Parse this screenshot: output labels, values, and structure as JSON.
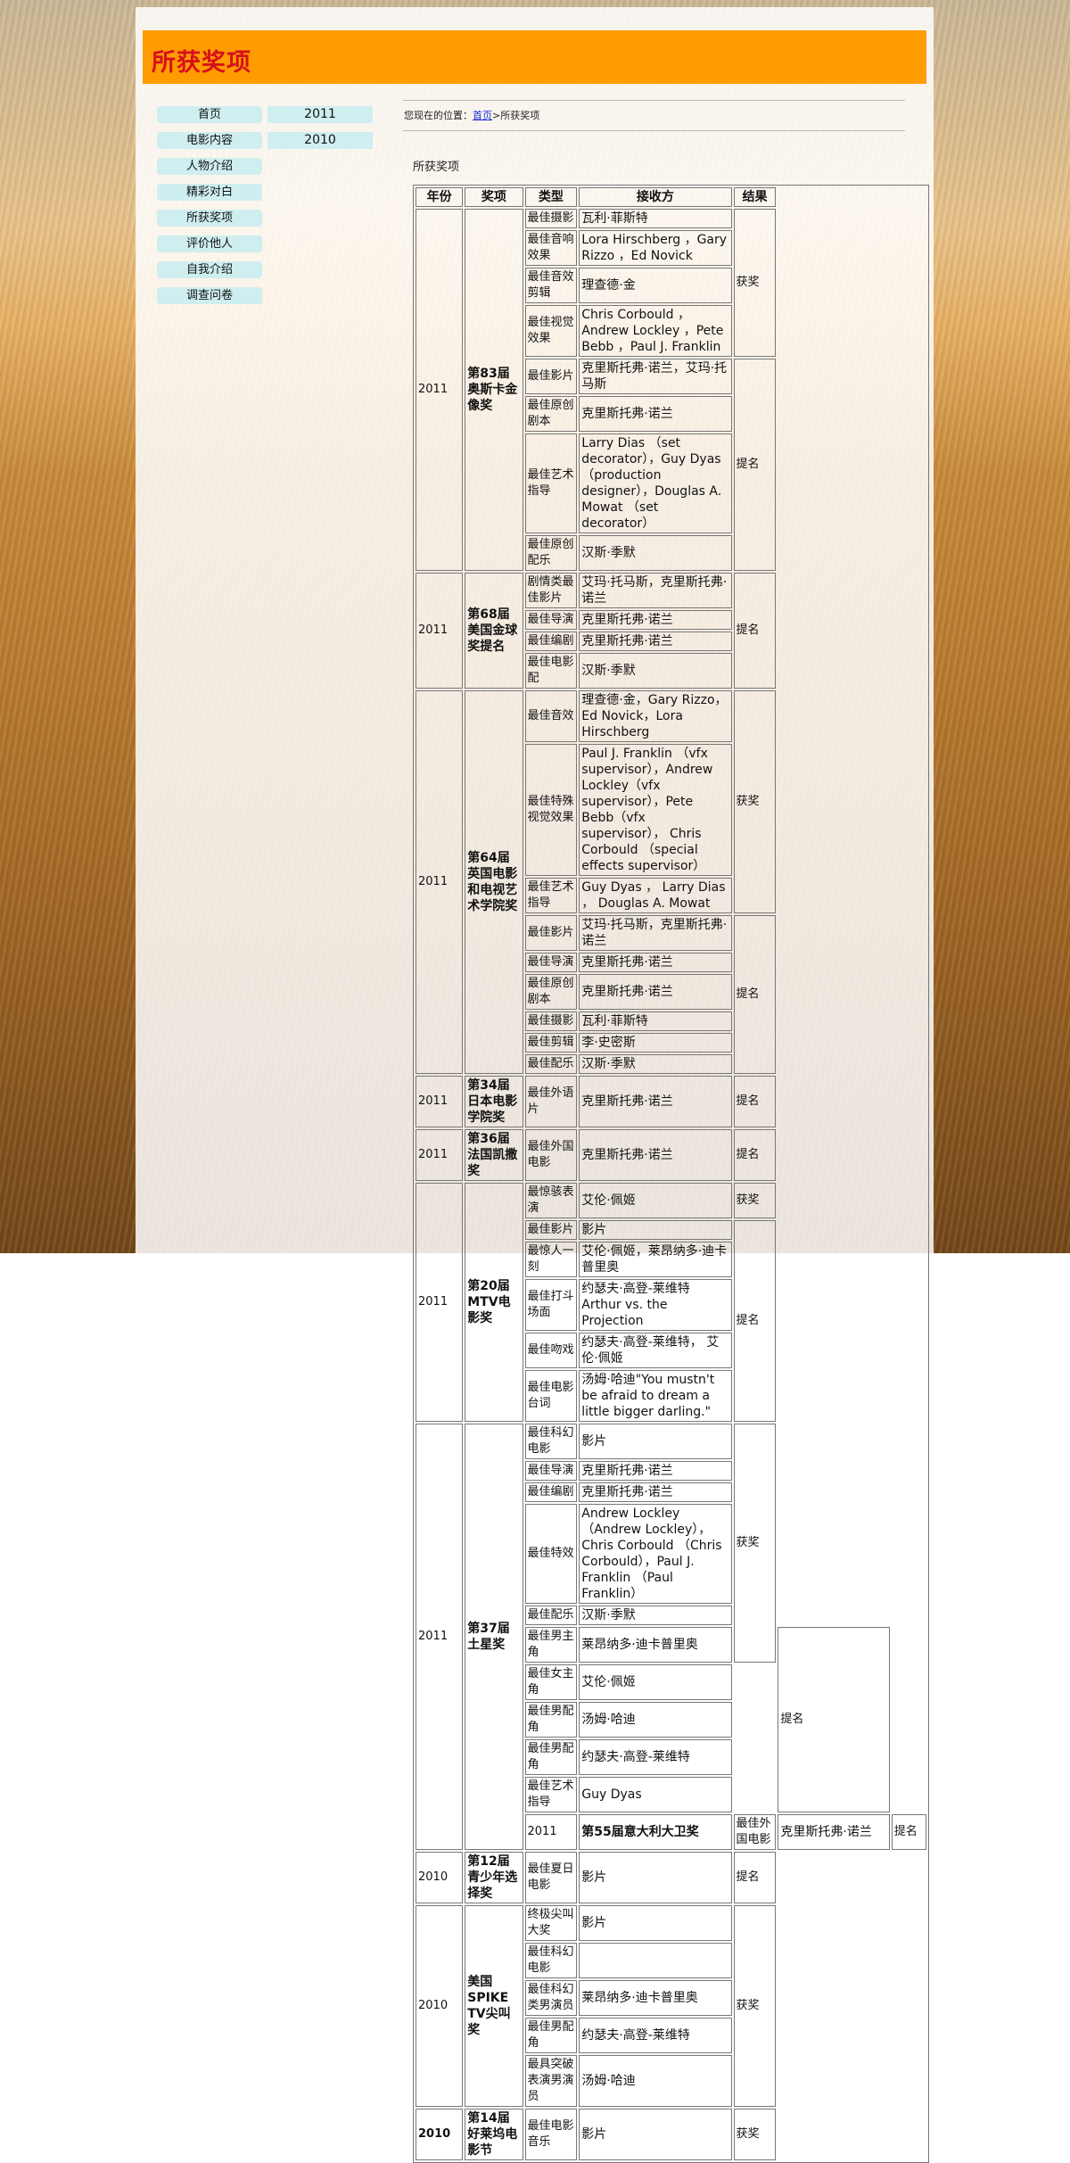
{
  "banner": {
    "title": "所获奖项"
  },
  "nav": {
    "items": [
      "首页",
      "电影内容",
      "人物介绍",
      "精彩对白",
      "所获奖项",
      "评价他人",
      "自我介绍",
      "调查问卷"
    ]
  },
  "years": [
    "2011",
    "2010"
  ],
  "breadcrumb": {
    "prefix": "您现在的位置：",
    "home": "首页",
    "sep": ">",
    "current": "所获奖项"
  },
  "section_title": "所获奖项",
  "table": {
    "headers": [
      "年份",
      "奖项",
      "类型",
      "接收方",
      "结果"
    ],
    "rows": [
      {
        "y": "2011",
        "a": "第83届奥斯卡金像奖",
        "t": "最佳摄影",
        "r": "瓦利·菲斯特",
        "s": "获奖"
      },
      {
        "t": "最佳音响效果",
        "r": "Lora Hirschberg ，Gary Rizzo ，Ed Novick"
      },
      {
        "t": "最佳音效剪辑",
        "r": "理查德·金"
      },
      {
        "t": "最佳视觉效果",
        "r": "Chris Corbould ，Andrew Lockley ，Pete Bebb ，Paul J. Franklin"
      },
      {
        "t": "最佳影片",
        "r": "克里斯托弗·诺兰，艾玛·托马斯",
        "s": "提名"
      },
      {
        "t": "最佳原创剧本",
        "r": "克里斯托弗·诺兰"
      },
      {
        "t": "最佳艺术指导",
        "r": "Larry Dias （set decorator），Guy Dyas （production designer），Douglas A. Mowat （set decorator）"
      },
      {
        "t": "最佳原创配乐",
        "r": "汉斯·季默"
      },
      {
        "y": "2011",
        "a": "第68届美国金球奖提名",
        "t": "剧情类最佳影片",
        "r": "艾玛·托马斯，克里斯托弗·诺兰",
        "s": "提名"
      },
      {
        "t": "最佳导演",
        "r": "克里斯托弗·诺兰"
      },
      {
        "t": "最佳编剧",
        "r": "克里斯托弗·诺兰"
      },
      {
        "t": "最佳电影配",
        "r": "汉斯·季默"
      },
      {
        "y": "2011",
        "a": "第64届英国电影和电视艺术学院奖",
        "t": "最佳音效",
        "r": "理查德·金，Gary Rizzo，Ed Novick，Lora Hirschberg",
        "s": "获奖"
      },
      {
        "t": "最佳特殊视觉效果",
        "r": "Paul J. Franklin （vfx supervisor），Andrew Lockley（vfx supervisor），Pete Bebb（vfx supervisor）， Chris Corbould （special effects supervisor）"
      },
      {
        "t": "最佳艺术指导",
        "r": "Guy Dyas ， Larry Dias ， Douglas A. Mowat"
      },
      {
        "t": "最佳影片",
        "r": "艾玛·托马斯，克里斯托弗·诺兰",
        "s": "提名"
      },
      {
        "t": "最佳导演",
        "r": "克里斯托弗·诺兰"
      },
      {
        "t": "最佳原创剧本",
        "r": "克里斯托弗·诺兰"
      },
      {
        "t": "最佳摄影",
        "r": "瓦利·菲斯特"
      },
      {
        "t": "最佳剪辑",
        "r": "李·史密斯"
      },
      {
        "t": "最佳配乐",
        "r": "汉斯·季默"
      },
      {
        "y": "2011",
        "a": "第34届日本电影学院奖",
        "t": "最佳外语片",
        "r": "克里斯托弗·诺兰",
        "s": "提名"
      },
      {
        "y": "2011",
        "a": "第36届法国凯撒奖",
        "t": "最佳外国电影",
        "r": "克里斯托弗·诺兰",
        "s": "提名"
      },
      {
        "y": "2011",
        "a": "第20届MTV电影奖",
        "t": "最惊骇表演",
        "r": "艾伦·佩姬",
        "s": "获奖"
      },
      {
        "t": "最佳影片",
        "r": "影片",
        "s": "提名"
      },
      {
        "t": "最惊人一刻",
        "r": "艾伦·佩姬，莱昂纳多·迪卡普里奥"
      },
      {
        "t": "最佳打斗场面",
        "r": "约瑟夫·高登-莱维特　 Arthur vs. the Projection"
      },
      {
        "t": "最佳吻戏",
        "r": "约瑟夫·高登-莱维特， 艾伦·佩姬"
      },
      {
        "t": "最佳电影台词",
        "r": "汤姆·哈迪\"You mustn't be afraid to dream a little bigger darling.\""
      },
      {
        "y": "2011",
        "a": "第37届土星奖",
        "t": "最佳科幻电影",
        "r": "影片",
        "s": "获奖"
      },
      {
        "t": "最佳导演",
        "r": "克里斯托弗·诺兰"
      },
      {
        "t": "最佳编剧",
        "r": "克里斯托弗·诺兰"
      },
      {
        "t": "最佳特效",
        "r": "Andrew Lockley（Andrew Lockley），Chris Corbould （Chris Corbould），Paul J. Franklin （Paul Franklin）"
      },
      {
        "t": "最佳配乐",
        "r": "汉斯·季默"
      },
      {
        "t": "最佳男主角",
        "r": "莱昂纳多·迪卡普里奥",
        "s": "提名"
      },
      {
        "t": "最佳女主角",
        "r": "艾伦·佩姬"
      },
      {
        "t": "最佳男配角",
        "r": "汤姆·哈迪"
      },
      {
        "t": "最佳男配角",
        "r": "约瑟夫·高登-莱维特"
      },
      {
        "t": "最佳艺术指导",
        "r": "Guy Dyas"
      },
      {
        "y": "2011",
        "a": "第55届意大利大卫奖",
        "t": "最佳外国电影",
        "r": "克里斯托弗·诺兰",
        "s": "提名"
      },
      {
        "y": "2010",
        "a": "第12届青少年选择奖",
        "t": "最佳夏日电影",
        "r": "影片",
        "s": "提名"
      },
      {
        "y": "2010",
        "a": "美国SPIKE TV尖叫奖",
        "t": "终极尖叫大奖",
        "r": "影片",
        "s": "获奖"
      },
      {
        "t": "最佳科幻电影",
        "r": ""
      },
      {
        "t": "最佳科幻类男演员",
        "r": "莱昂纳多·迪卡普里奥"
      },
      {
        "t": "最佳男配角",
        "r": "约瑟夫·高登-莱维特"
      },
      {
        "t": "最具突破表演男演员",
        "r": "汤姆·哈迪"
      },
      {
        "y": "2010",
        "a": "第14届好莱坞电影节",
        "t": "最佳电影音乐",
        "r": "影片",
        "s": "获奖"
      }
    ]
  }
}
